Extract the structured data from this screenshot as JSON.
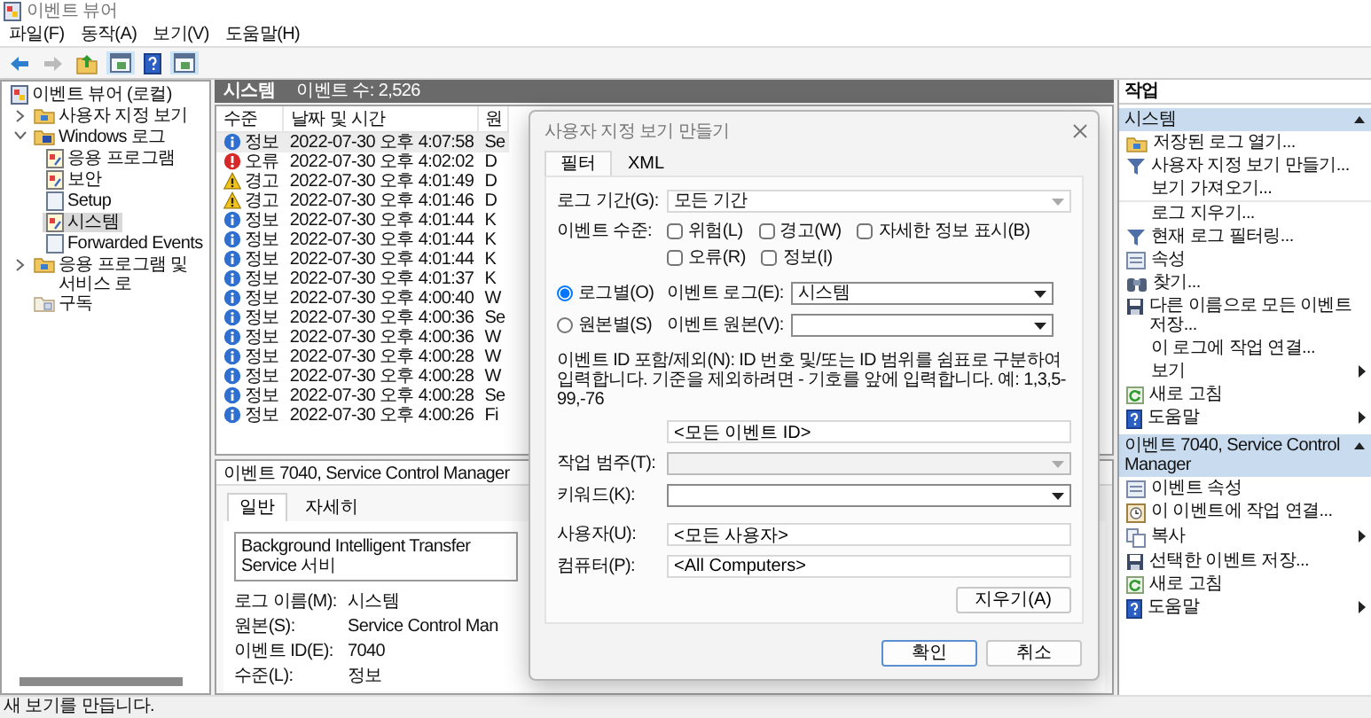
{
  "window": {
    "title": "이벤트 뷰어"
  },
  "menu": [
    "파일(F)",
    "동작(A)",
    "보기(V)",
    "도움말(H)"
  ],
  "toolbar": [
    {
      "kind": "back",
      "disabled": false
    },
    {
      "kind": "forward",
      "disabled": true
    },
    {
      "kind": "up",
      "on": false
    },
    {
      "kind": "pane",
      "on": true
    },
    {
      "kind": "help",
      "on": false
    },
    {
      "kind": "pane",
      "on": true
    }
  ],
  "tree": {
    "label": "이벤트 뷰어 (로컬)",
    "kind": "viewer",
    "selected": false,
    "children": [
      {
        "label": "사용자 지정 보기",
        "kind": "folder",
        "expanded": false,
        "selected": false
      },
      {
        "label": "Windows 로그",
        "kind": "log-folder",
        "expanded": true,
        "selected": false,
        "children": [
          {
            "label": "응용 프로그램",
            "kind": "log",
            "selected": false
          },
          {
            "label": "보안",
            "kind": "log",
            "selected": false
          },
          {
            "label": "Setup",
            "kind": "page",
            "selected": false
          },
          {
            "label": "시스템",
            "kind": "log",
            "selected": true
          },
          {
            "label": "Forwarded Events",
            "kind": "page",
            "selected": false
          }
        ]
      },
      {
        "label": "응용 프로그램 및 서비스 로",
        "kind": "folder",
        "expanded": false,
        "selected": false
      },
      {
        "label": "구독",
        "kind": "subscription",
        "selected": false
      }
    ]
  },
  "log_header": {
    "title": "시스템",
    "count": "이벤트 수: 2,526"
  },
  "events": {
    "columns": [
      "수준",
      "날짜 및 시간",
      "원"
    ],
    "rows": [
      {
        "kind": "info",
        "level": "정보",
        "date": "2022-07-30 오후 4:07:58",
        "column_3": "Se",
        "selected": true
      },
      {
        "kind": "error",
        "level": "오류",
        "date": "2022-07-30 오후 4:02:02",
        "column_3": "D",
        "selected": false
      },
      {
        "kind": "warning",
        "level": "경고",
        "date": "2022-07-30 오후 4:01:49",
        "column_3": "D",
        "selected": false
      },
      {
        "kind": "warning",
        "level": "경고",
        "date": "2022-07-30 오후 4:01:46",
        "column_3": "D",
        "selected": false
      },
      {
        "kind": "info",
        "level": "정보",
        "date": "2022-07-30 오후 4:01:44",
        "column_3": "K",
        "selected": false
      },
      {
        "kind": "info",
        "level": "정보",
        "date": "2022-07-30 오후 4:01:44",
        "column_3": "K",
        "selected": false
      },
      {
        "kind": "info",
        "level": "정보",
        "date": "2022-07-30 오후 4:01:44",
        "column_3": "K",
        "selected": false
      },
      {
        "kind": "info",
        "level": "정보",
        "date": "2022-07-30 오후 4:01:37",
        "column_3": "K",
        "selected": false
      },
      {
        "kind": "info",
        "level": "정보",
        "date": "2022-07-30 오후 4:00:40",
        "column_3": "W",
        "selected": false
      },
      {
        "kind": "info",
        "level": "정보",
        "date": "2022-07-30 오후 4:00:36",
        "column_3": "Se",
        "selected": false
      },
      {
        "kind": "info",
        "level": "정보",
        "date": "2022-07-30 오후 4:00:36",
        "column_3": "W",
        "selected": false
      },
      {
        "kind": "info",
        "level": "정보",
        "date": "2022-07-30 오후 4:00:28",
        "column_3": "W",
        "selected": false
      },
      {
        "kind": "info",
        "level": "정보",
        "date": "2022-07-30 오후 4:00:28",
        "column_3": "W",
        "selected": false
      },
      {
        "kind": "info",
        "level": "정보",
        "date": "2022-07-30 오후 4:00:28",
        "column_3": "Se",
        "selected": false
      },
      {
        "kind": "info",
        "level": "정보",
        "date": "2022-07-30 오후 4:00:26",
        "column_3": "Fi",
        "selected": false
      }
    ]
  },
  "detail": {
    "title": "이벤트 7040, Service Control Manager",
    "tabs": [
      {
        "label": "일반",
        "selected": true
      },
      {
        "label": "자세히",
        "selected": false
      }
    ],
    "description": "Background Intelligent Transfer Service 서비",
    "fields": [
      {
        "label": "로그 이름(M):",
        "value": "시스템"
      },
      {
        "label": "원본(S):",
        "value": "Service Control Man"
      },
      {
        "label": "이벤트 ID(E):",
        "value": "7040"
      },
      {
        "label": "수준(L):",
        "value": "정보"
      }
    ]
  },
  "dialog": {
    "title": "사용자 지정 보기 만들기",
    "tabs": [
      {
        "label": "필터",
        "selected": true
      },
      {
        "label": "XML",
        "selected": false
      }
    ],
    "period": {
      "label": "로그 기간(G):",
      "value": "모든 기간"
    },
    "levels": {
      "label": "이벤트 수준:",
      "options": [
        {
          "label": "위험(L)",
          "checked": false
        },
        {
          "label": "경고(W)",
          "checked": false
        },
        {
          "label": "자세한 정보 표시(B)",
          "checked": false
        },
        {
          "label": "오류(R)",
          "checked": false
        },
        {
          "label": "정보(I)",
          "checked": false
        }
      ]
    },
    "modes": [
      {
        "label": "로그별(O)",
        "selected": true,
        "field_label": "이벤트 로그(E):",
        "value": "시스템"
      },
      {
        "label": "원본별(S)",
        "selected": false,
        "field_label": "이벤트 원본(V):"
      }
    ],
    "id_help": "이벤트 ID 포함/제외(N): ID 번호 및/또는 ID 범위를 쉼표로 구분하여 입력합니다. 기준을 제외하려면 - 기호를 앞에 입력합니다. 예: 1,3,5-99,-76",
    "id_value": "<모든 이벤트 ID>",
    "category": {
      "label": "작업 범주(T):",
      "disabled": true
    },
    "keyword": {
      "label": "키워드(K):",
      "disabled": false
    },
    "user": {
      "label": "사용자(U):",
      "value": "<모든 사용자>"
    },
    "computer": {
      "label": "컴퓨터(P):",
      "value": "<All Computers>"
    },
    "clear_button": "지우기(A)",
    "buttons": [
      {
        "label": "확인",
        "default": true
      },
      {
        "label": "취소",
        "default": false
      }
    ]
  },
  "actions": {
    "title": "작업",
    "sections": [
      {
        "title": "시스템",
        "expanded": true,
        "items": [
          {
            "label": "저장된 로그 열기...",
            "kind": "folder",
            "submenu": false,
            "separator": false
          },
          {
            "label": "사용자 지정 보기 만들기...",
            "kind": "filter",
            "submenu": false,
            "separator": false
          },
          {
            "label": "보기 가져오기...",
            "kind": "none",
            "submenu": false,
            "separator": false
          },
          {
            "label": "로그 지우기...",
            "kind": "none",
            "submenu": false,
            "separator": true
          },
          {
            "label": "현재 로그 필터링...",
            "kind": "filter",
            "submenu": false,
            "separator": false
          },
          {
            "label": "속성",
            "kind": "window",
            "submenu": false,
            "separator": false
          },
          {
            "label": "찾기...",
            "kind": "binoculars",
            "submenu": false,
            "separator": false
          },
          {
            "label": "다른 이름으로 모든 이벤트 저장...",
            "kind": "save",
            "submenu": false,
            "separator": false
          },
          {
            "label": "이 로그에 작업 연결...",
            "kind": "none",
            "submenu": false,
            "separator": false
          },
          {
            "label": "보기",
            "kind": "none",
            "submenu": true,
            "separator": false
          },
          {
            "label": "새로 고침",
            "kind": "refresh",
            "submenu": false,
            "separator": false
          },
          {
            "label": "도움말",
            "kind": "help",
            "submenu": true,
            "separator": false
          }
        ]
      },
      {
        "title": "이벤트 7040, Service Control Manager",
        "expanded": true,
        "items": [
          {
            "label": "이벤트 속성",
            "kind": "window",
            "submenu": false,
            "separator": false
          },
          {
            "label": "이 이벤트에 작업 연결...",
            "kind": "task",
            "submenu": false,
            "separator": false
          },
          {
            "label": "복사",
            "kind": "copy",
            "submenu": true,
            "separator": false
          },
          {
            "label": "선택한 이벤트 저장...",
            "kind": "save",
            "submenu": false,
            "separator": false
          },
          {
            "label": "새로 고침",
            "kind": "refresh",
            "submenu": false,
            "separator": false
          },
          {
            "label": "도움말",
            "kind": "help",
            "submenu": true,
            "separator": false
          }
        ]
      }
    ]
  },
  "status_bar": "새 보기를 만듭니다."
}
